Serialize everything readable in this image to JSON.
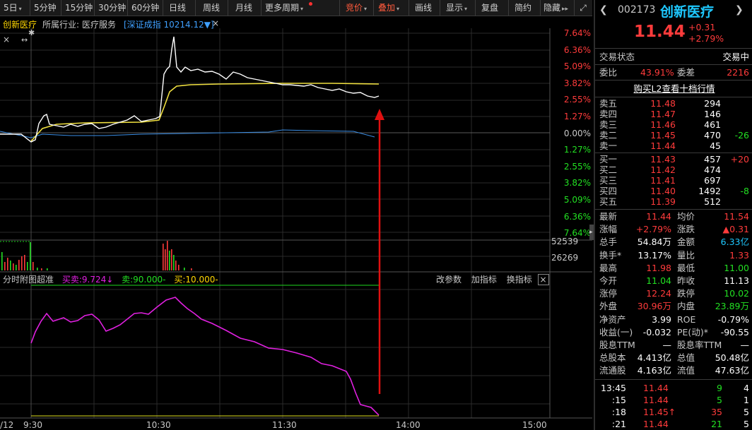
{
  "toolbar": {
    "items": [
      "5日",
      "5分钟",
      "15分钟",
      "30分钟",
      "60分钟",
      "日线",
      "周线",
      "月线",
      "更多周期",
      "竞价",
      "叠加",
      "画线",
      "显示",
      "复盘",
      "简约",
      "隐藏"
    ],
    "expand_icon": "expand-icon"
  },
  "infobar": {
    "stock_name": "创新医疗",
    "industry_label": "所属行业:",
    "industry": "医疗服务",
    "index": "[深证成指 10214.12▼]",
    "close": "×"
  },
  "pct_labels": [
    "7.64%",
    "6.36%",
    "5.09%",
    "3.82%",
    "2.55%",
    "1.27%",
    "0.00%",
    "1.27%",
    "2.55%",
    "3.82%",
    "5.09%",
    "6.36%",
    "7.64%"
  ],
  "volume_labels": [
    "52539",
    "26269"
  ],
  "indicator": {
    "name": "分时附图超准",
    "buysell": "买卖:9.724↓",
    "sell": "卖:90.000-",
    "buy": "买:10.000-",
    "btn_params": "改参数",
    "btn_add": "加指标",
    "btn_change": "换指标",
    "btn_close": "×"
  },
  "time_labels": [
    "/12",
    "9:30",
    "10:30",
    "11:30",
    "14:00",
    "15:00"
  ],
  "quote": {
    "code": "002173",
    "name": "创新医疗",
    "price": "11.44",
    "change": "+0.31",
    "change_pct": "+2.79%",
    "status_label": "交易状态",
    "status": "交易中",
    "weibi_label": "委比",
    "weibi": "43.91%",
    "weicha_label": "委差",
    "weicha": "2216",
    "l2_link": "购买L2查看十档行情"
  },
  "order_book": {
    "asks": [
      {
        "label": "卖五",
        "price": "11.48",
        "vol": "294",
        "chg": ""
      },
      {
        "label": "卖四",
        "price": "11.47",
        "vol": "146",
        "chg": ""
      },
      {
        "label": "卖三",
        "price": "11.46",
        "vol": "461",
        "chg": ""
      },
      {
        "label": "卖二",
        "price": "11.45",
        "vol": "470",
        "chg": "-26"
      },
      {
        "label": "卖一",
        "price": "11.44",
        "vol": "45",
        "chg": ""
      }
    ],
    "bids": [
      {
        "label": "买一",
        "price": "11.43",
        "vol": "457",
        "chg": "+20"
      },
      {
        "label": "买二",
        "price": "11.42",
        "vol": "474",
        "chg": ""
      },
      {
        "label": "买三",
        "price": "11.41",
        "vol": "697",
        "chg": ""
      },
      {
        "label": "买四",
        "price": "11.40",
        "vol": "1492",
        "chg": "-8"
      },
      {
        "label": "买五",
        "price": "11.39",
        "vol": "512",
        "chg": ""
      }
    ]
  },
  "stats": [
    {
      "l1": "最新",
      "v1": "11.44",
      "c1": "red",
      "l2": "均价",
      "v2": "11.54",
      "c2": "red"
    },
    {
      "l1": "涨幅",
      "v1": "+2.79%",
      "c1": "red",
      "l2": "涨跌",
      "v2": "▲0.31",
      "c2": "red"
    },
    {
      "l1": "总手",
      "v1": "54.84万",
      "c1": "white",
      "l2": "金额",
      "v2": "6.33亿",
      "c2": "cyan"
    },
    {
      "l1": "换手*",
      "v1": "13.17%",
      "c1": "white",
      "l2": "量比",
      "v2": "1.33",
      "c2": "red"
    },
    {
      "l1": "最高",
      "v1": "11.98",
      "c1": "red",
      "l2": "最低",
      "v2": "11.00",
      "c2": "green"
    },
    {
      "l1": "今开",
      "v1": "11.04",
      "c1": "green",
      "l2": "昨收",
      "v2": "11.13",
      "c2": "white"
    },
    {
      "l1": "涨停",
      "v1": "12.24",
      "c1": "red",
      "l2": "跌停",
      "v2": "10.02",
      "c2": "green"
    },
    {
      "l1": "外盘",
      "v1": "30.96万",
      "c1": "red",
      "l2": "内盘",
      "v2": "23.89万",
      "c2": "green"
    },
    {
      "l1": "净资产",
      "v1": "3.99",
      "c1": "white",
      "l2": "ROE",
      "v2": "-0.79%",
      "c2": "white"
    },
    {
      "l1": "收益(一)",
      "v1": "-0.032",
      "c1": "white",
      "l2": "PE(动)*",
      "v2": "-90.55",
      "c2": "white"
    },
    {
      "l1": "股息TTM",
      "v1": "—",
      "c1": "white",
      "l2": "股息率TTM",
      "v2": "—",
      "c2": "white"
    },
    {
      "l1": "总股本",
      "v1": "4.413亿",
      "c1": "white",
      "l2": "总值",
      "v2": "50.48亿",
      "c2": "white"
    },
    {
      "l1": "流通股",
      "v1": "4.163亿",
      "c1": "white",
      "l2": "流值",
      "v2": "47.63亿",
      "c2": "white"
    }
  ],
  "ticks": [
    {
      "time": "13:45",
      "price": "11.44",
      "vol": "9",
      "n": "4",
      "pc": "red",
      "vc": "green"
    },
    {
      "time": ":15",
      "price": "11.44",
      "vol": "5",
      "n": "1",
      "pc": "red",
      "vc": "green"
    },
    {
      "time": ":18",
      "price": "11.45↑",
      "vol": "35",
      "n": "5",
      "pc": "red",
      "vc": "red"
    },
    {
      "time": ":21",
      "price": "11.44",
      "vol": "21",
      "n": "5",
      "pc": "red",
      "vc": "green"
    }
  ],
  "colors": {
    "up": "#ff3b3b",
    "down": "#22e022",
    "price_line": "#ffffff",
    "avg_line": "#f0e040",
    "index_line": "#3a8ee6",
    "indicator_line": "#e020e0",
    "arrow": "#e01010",
    "accent": "#ff5a3c"
  }
}
